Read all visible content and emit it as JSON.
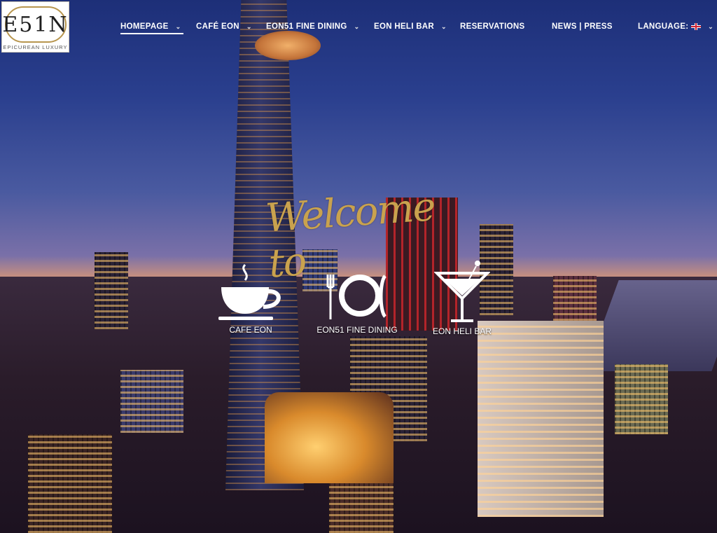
{
  "logo": {
    "mark": "E51N",
    "tagline": "EPICUREAN LUXURY"
  },
  "nav": {
    "items": [
      {
        "label": "HOMEPAGE",
        "dropdown": true,
        "active": true
      },
      {
        "label": "CAFÉ EON",
        "dropdown": true,
        "active": false
      },
      {
        "label": "EON51 FINE DINING",
        "dropdown": true,
        "active": false
      },
      {
        "label": "EON HELI BAR",
        "dropdown": true,
        "active": false
      },
      {
        "label": "RESERVATIONS",
        "dropdown": false,
        "active": false
      },
      {
        "label": "NEWS | PRESS",
        "dropdown": false,
        "active": false
      },
      {
        "label": "LANGUAGE:",
        "dropdown": true,
        "active": false
      }
    ],
    "language_flag": "uk-flag-icon"
  },
  "hero": {
    "welcome_text": "Welcome to"
  },
  "venues": [
    {
      "label": "CAFE EON",
      "icon": "coffee-cup-icon"
    },
    {
      "label": "EON51 FINE DINING",
      "icon": "plate-fork-icon"
    },
    {
      "label": "EON HELI BAR",
      "icon": "cocktail-glass-icon"
    }
  ],
  "colors": {
    "gold": "#c9a24e",
    "nav_text": "#ffffff",
    "logo_border": "#b8964e"
  }
}
